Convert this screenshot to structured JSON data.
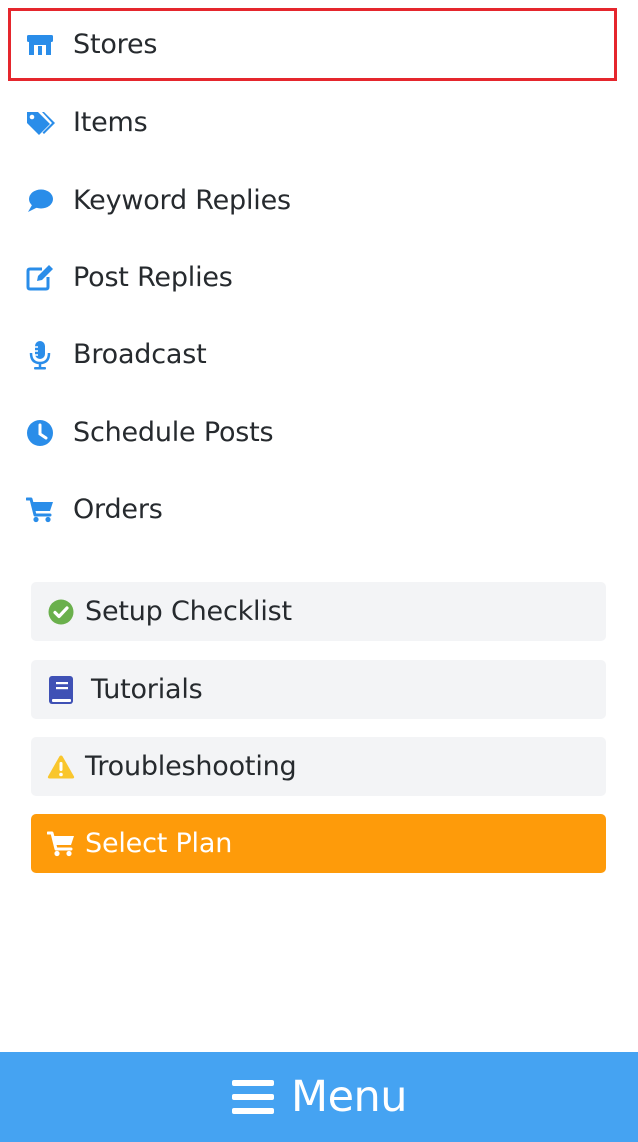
{
  "sidebar": {
    "items": [
      {
        "label": "Stores",
        "icon": "store-icon",
        "selected": true
      },
      {
        "label": "Items",
        "icon": "tags-icon"
      },
      {
        "label": "Keyword Replies",
        "icon": "comment-icon"
      },
      {
        "label": "Post Replies",
        "icon": "edit-icon"
      },
      {
        "label": "Broadcast",
        "icon": "microphone-icon"
      },
      {
        "label": "Schedule Posts",
        "icon": "clock-icon"
      },
      {
        "label": "Orders",
        "icon": "cart-icon"
      }
    ]
  },
  "actions": {
    "setup_checklist": {
      "label": "Setup Checklist",
      "icon": "check-circle-icon"
    },
    "tutorials": {
      "label": "Tutorials",
      "icon": "book-icon"
    },
    "troubleshooting": {
      "label": "Troubleshooting",
      "icon": "warning-icon"
    },
    "select_plan": {
      "label": "Select Plan",
      "icon": "cart-icon"
    }
  },
  "menu_bar": {
    "label": "Menu",
    "icon": "hamburger-icon"
  },
  "colors": {
    "accent_blue": "#2a8de9",
    "menu_bar_blue": "#45a3f2",
    "selected_border": "#e5262d",
    "select_plan_orange": "#fe9b0a",
    "check_green": "#6ab04c",
    "book_indigo": "#3f51b5",
    "warning_yellow": "#f9c62d",
    "action_bg": "#f3f4f6"
  }
}
